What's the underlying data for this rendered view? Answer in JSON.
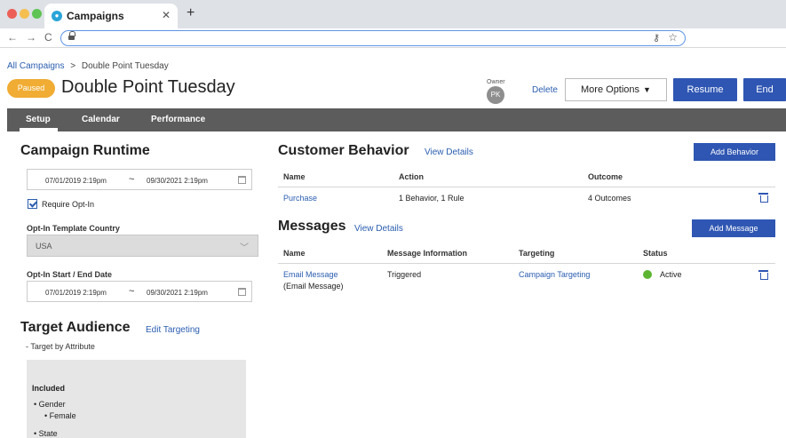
{
  "browser": {
    "tab_title": "Campaigns",
    "tab_close": "✕",
    "new_tab": "+",
    "back": "←",
    "forward": "→",
    "reload": "C"
  },
  "header": {
    "breadcrumb_root": "All Campaigns",
    "breadcrumb_sep": ">",
    "breadcrumb_current": "Double Point Tuesday",
    "status": "Paused",
    "title": "Double Point Tuesday",
    "owner_label": "Owner",
    "owner_initials": "PK",
    "delete_label": "Delete",
    "more_options_label": "More Options",
    "resume_label": "Resume",
    "end_label": "End",
    "colors": {
      "accent": "#2f56b3",
      "status": "#f0ac33"
    }
  },
  "subnav": {
    "tabs": [
      {
        "label": "Setup",
        "active": true
      },
      {
        "label": "Calendar",
        "active": false
      },
      {
        "label": "Performance",
        "active": false
      }
    ]
  },
  "runtime": {
    "title": "Campaign Runtime",
    "start": "07/01/2019 2:19pm",
    "tilde": "~",
    "end": "09/30/2021 2:19pm",
    "require_optin_label": "Require Opt-In",
    "require_optin_checked": true,
    "template_country_label": "Opt-In Template Country",
    "template_country_value": "USA",
    "optin_dates_label": "Opt-In Start / End Date",
    "optin_start": "07/01/2019 2:19pm",
    "optin_end": "09/30/2021 2:19pm"
  },
  "audience": {
    "title": "Target Audience",
    "edit_link": "Edit Targeting",
    "toggle_label": "- Target by Attribute",
    "included_label": "Included",
    "items": [
      {
        "label": "Gender",
        "sub": "Female"
      },
      {
        "label": "State"
      }
    ]
  },
  "behavior": {
    "title": "Customer Behavior",
    "view_details": "View Details",
    "add_button": "Add Behavior",
    "columns": [
      "Name",
      "Action",
      "Outcome"
    ],
    "rows": [
      {
        "name": "Purchase",
        "action": "1 Behavior, 1 Rule",
        "outcome": "4 Outcomes"
      }
    ]
  },
  "messages": {
    "title": "Messages",
    "view_details": "View Details",
    "add_button": "Add Message",
    "columns": [
      "Name",
      "Message Information",
      "Targeting",
      "Status"
    ],
    "rows": [
      {
        "name": "Email Message",
        "subtitle": "(Email Message)",
        "info": "Triggered",
        "targeting": "Campaign Targeting",
        "status": "Active"
      }
    ]
  }
}
